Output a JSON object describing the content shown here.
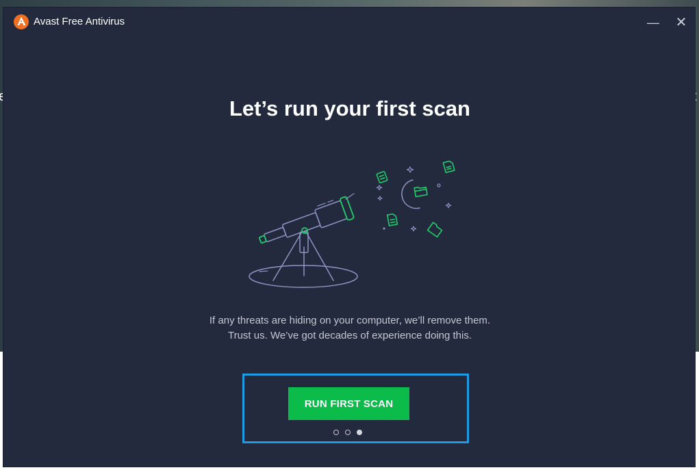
{
  "app": {
    "title": "Avast Free Antivirus",
    "logo_icon": "avast-logo-icon",
    "minimize_icon": "minimize-icon",
    "close_icon": "close-icon",
    "minimize_glyph": "—",
    "close_glyph": "✕"
  },
  "background": {
    "left_char": "e",
    "right_char": "t"
  },
  "onboarding": {
    "headline": "Let’s run your first scan",
    "illustration_icon": "telescope-illustration",
    "description_line1": "If any threats are hiding on your computer, we’ll remove them.",
    "description_line2": "Trust us. We’ve got decades of experience doing this.",
    "cta_label": "RUN FIRST SCAN",
    "pagination": {
      "total": 3,
      "current": 3
    }
  },
  "colors": {
    "window_bg": "#232a3e",
    "accent_green": "#0cbc4a",
    "brand_orange": "#f26f21",
    "highlight_blue": "#1f9be1",
    "illustration_line": "#8d95c4",
    "illustration_green": "#1fcf6a"
  }
}
